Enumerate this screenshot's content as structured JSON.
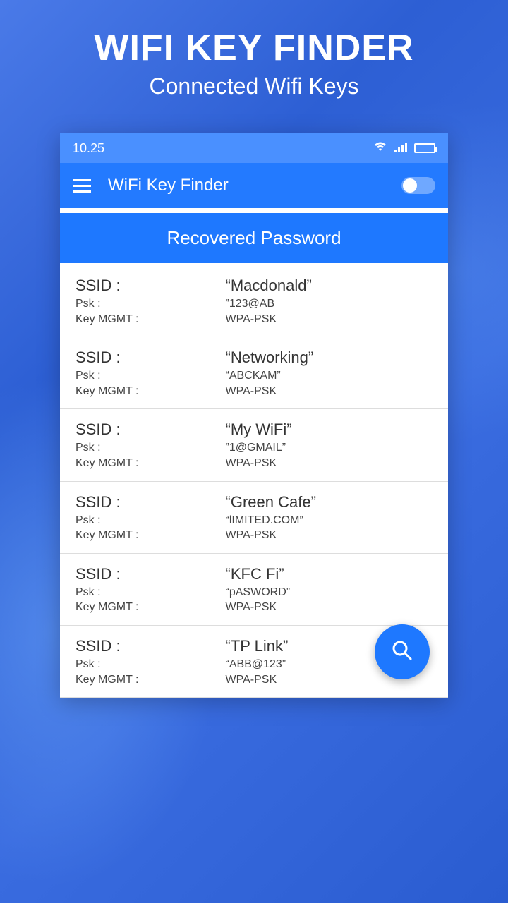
{
  "hero": {
    "title": "WIFI KEY FINDER",
    "subtitle": "Connected Wifi Keys"
  },
  "status": {
    "time": "10.25"
  },
  "appbar": {
    "title": "WiFi Key Finder"
  },
  "section": {
    "title": "Recovered Password"
  },
  "labels": {
    "ssid": "SSID :",
    "psk": "Psk :",
    "keymgmt": "Key MGMT :"
  },
  "items": [
    {
      "ssid": "“Macdonald”",
      "psk": "”123@AB",
      "keymgmt": "WPA-PSK"
    },
    {
      "ssid": "“Networking”",
      "psk": "“ABCKAM”",
      "keymgmt": "WPA-PSK"
    },
    {
      "ssid": "“My WiFi”",
      "psk": "”1@GMAIL”",
      "keymgmt": "WPA-PSK"
    },
    {
      "ssid": "“Green Cafe”",
      "psk": "“lIMITED.COM”",
      "keymgmt": "WPA-PSK"
    },
    {
      "ssid": "“KFC Fi”",
      "psk": "“pASWORD”",
      "keymgmt": "WPA-PSK"
    },
    {
      "ssid": "“TP Link”",
      "psk": "“ABB@123”",
      "keymgmt": "WPA-PSK"
    }
  ]
}
